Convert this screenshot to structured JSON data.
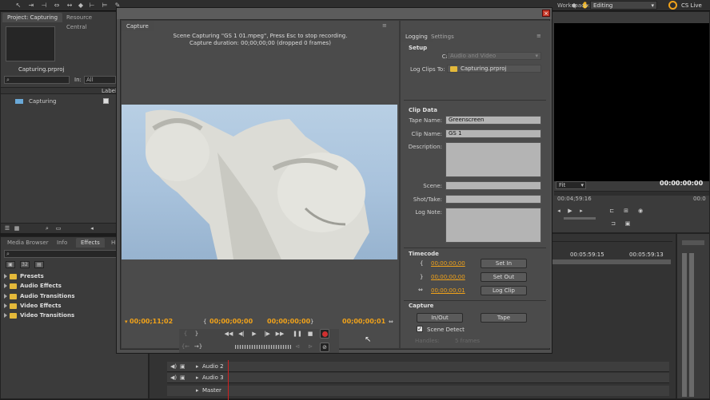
{
  "topbar": {
    "workspace_label": "Workspace:",
    "workspace_value": "Editing",
    "cs_live": "CS Live"
  },
  "project": {
    "tab_project": "Project: Capturing",
    "tab_resource": "Resource Central",
    "file_name": "Capturing.prproj",
    "in_label": "In:",
    "in_value": "All",
    "col_label": "Label",
    "item_name": "Capturing"
  },
  "effects": {
    "tabs": [
      "Media Browser",
      "Info",
      "Effects",
      "Hi"
    ],
    "items": [
      "Presets",
      "Audio Effects",
      "Audio Transitions",
      "Video Effects",
      "Video Transitions"
    ]
  },
  "program": {
    "fit": "Fit",
    "timecode": "00:00:00:00",
    "timecode_left": "00:04;59:16",
    "timecode_right": "00:0"
  },
  "timeline": {
    "ruler1": "00:05:59:15",
    "ruler2": "00:05:59:13",
    "tracks": [
      "Audio 2",
      "Audio 3",
      "Master"
    ]
  },
  "capture": {
    "title": "Capture",
    "status_line1": "Scene Capturing \"GS 1 01.mpeg\", Press Esc to stop recording.",
    "status_line2": "Capture duration: 00;00;00;00  (dropped 0 frames)",
    "tc_current": "00;00;11;02",
    "tc_in": "00;00;00;00",
    "tc_out": "00;00;00;00",
    "tc_duration": "00;00;00;01",
    "tabs": {
      "logging": "Logging",
      "settings": "Settings"
    },
    "setup": {
      "heading": "Setup",
      "capture_label": "Capture:",
      "capture_value": "Audio and Video",
      "log_label": "Log Clips To:",
      "log_value": "Capturing.prproj"
    },
    "clip_data": {
      "heading": "Clip Data",
      "tape_label": "Tape Name:",
      "tape_value": "Greenscreen",
      "clip_label": "Clip Name:",
      "clip_value": "GS 1",
      "desc_label": "Description:",
      "scene_label": "Scene:",
      "shot_label": "Shot/Take:",
      "log_note_label": "Log Note:"
    },
    "timecode": {
      "heading": "Timecode",
      "in_value": "00;00;00;00",
      "out_value": "00;00;00;00",
      "dur_value": "00;00;00;01",
      "set_in": "Set In",
      "set_out": "Set Out",
      "log_clip": "Log Clip"
    },
    "capture_section": {
      "heading": "Capture",
      "in_out": "In/Out",
      "tape": "Tape",
      "scene_detect": "Scene Detect",
      "handles_label": "Handles:",
      "handles_value": "5 frames"
    }
  }
}
